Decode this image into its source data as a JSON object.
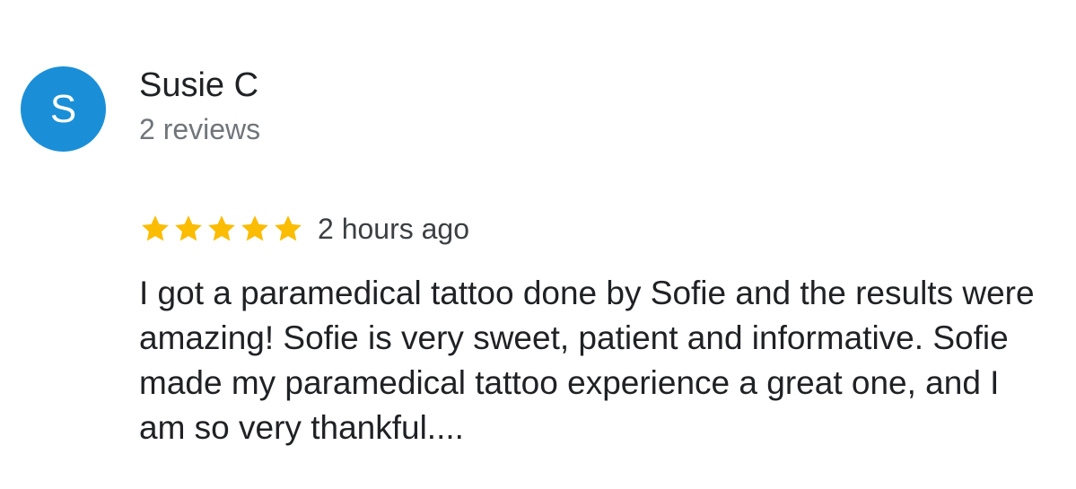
{
  "review": {
    "author": {
      "initial": "S",
      "name": "Susie C",
      "meta": "2 reviews",
      "avatar_color": "#1a8fd8"
    },
    "rating": {
      "stars": 5,
      "max": 5,
      "star_color": "#fbbc04"
    },
    "time": "2 hours ago",
    "text": "I got a paramedical tattoo done by Sofie and the results were amazing! Sofie is very sweet, patient and informative. Sofie made my paramedical tattoo experience a great one, and I am so very thankful...."
  }
}
